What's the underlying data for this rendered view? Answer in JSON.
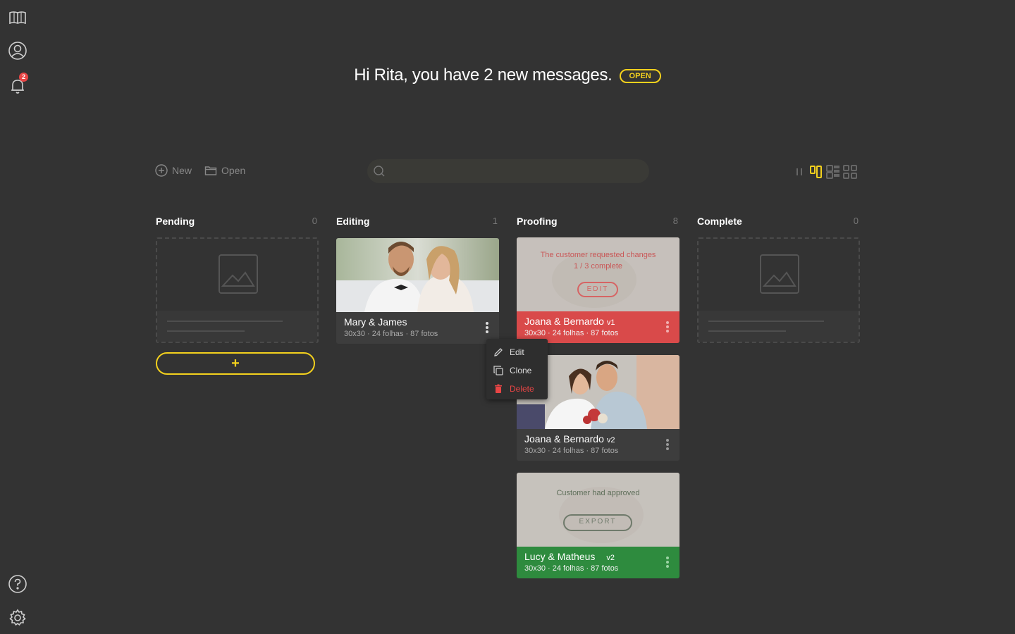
{
  "greeting": {
    "text": "Hi Rita, you have 2 new messages.",
    "open_label": "OPEN"
  },
  "sidebar": {
    "notification_count": "2"
  },
  "toolbar": {
    "new_label": "New",
    "open_label": "Open",
    "search_placeholder": ""
  },
  "columns": [
    {
      "title": "Pending",
      "count": "0"
    },
    {
      "title": "Editing",
      "count": "1"
    },
    {
      "title": "Proofing",
      "count": "8"
    },
    {
      "title": "Complete",
      "count": "0"
    }
  ],
  "add_button": {
    "label": "+"
  },
  "cards": {
    "mary_james": {
      "name": "Mary & James",
      "meta": "30x30 · 24 folhas · 87 fotos"
    },
    "joana_v1": {
      "name": "Joana & Bernardo",
      "version": "v1",
      "meta": "30x30 · 24 folhas · 87 fotos",
      "overlay_line1": "The customer requested changes",
      "overlay_line2": "1 / 3 complete",
      "action": "EDIT"
    },
    "joana_v2": {
      "name": "Joana & Bernardo",
      "version": "v2",
      "meta": "30x30 · 24 folhas · 87 fotos"
    },
    "lucy_matheus": {
      "name": "Lucy & Matheus",
      "version": "v2",
      "meta": "30x30 · 24 folhas · 87 fotos",
      "overlay_line1": "Customer had approved",
      "action": "EXPORT"
    }
  },
  "context_menu": {
    "edit": "Edit",
    "clone": "Clone",
    "delete": "Delete"
  },
  "colors": {
    "accent": "#f4d11d",
    "danger": "#e84545",
    "success": "#2e8b3e",
    "background": "#333333"
  }
}
